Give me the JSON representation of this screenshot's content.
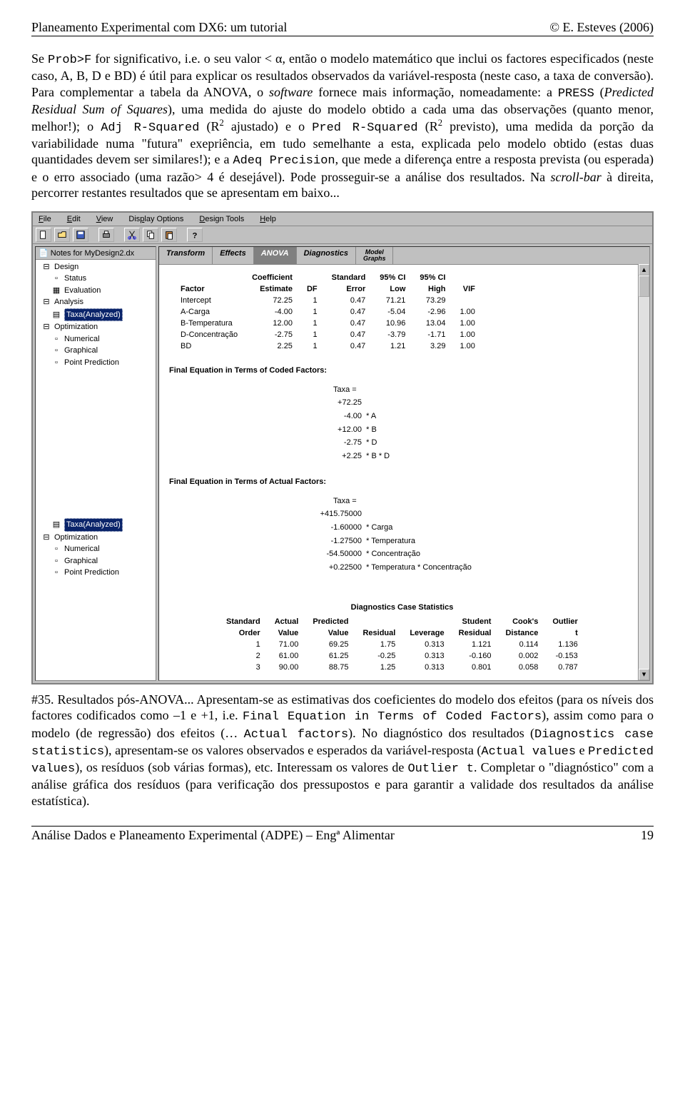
{
  "header": {
    "left": "Planeamento Experimental com DX6: um tutorial",
    "right": "© E. Esteves (2006)"
  },
  "para1": {
    "t1": "Se ",
    "t2": "Prob>F",
    "t3": " for significativo, i.e. o seu valor < α, então o modelo matemático que inclui os factores especificados (neste caso, A, B, D e BD) é útil para explicar os resultados observados da variável-resposta (neste caso, a taxa de conversão). Para complementar a tabela da ANOVA, o ",
    "t4": "software",
    "t5": " fornece mais informação, nomeadamente: a ",
    "t6": "PRESS",
    "t7": " (",
    "t8": "Predicted Residual Sum of Squares",
    "t9": "), uma medida do ajuste do modelo obtido a cada uma das observações (quanto menor, melhor!); o ",
    "t10": "Adj R-Squared",
    "t11": " (R",
    "t12": " ajustado) e o ",
    "t13": "Pred R-Squared",
    "t14": " (R",
    "t15": " previsto), uma medida da porção da variabilidade numa \"futura\" exepriência, em tudo semelhante a esta, explicada pelo modelo obtido (estas duas quantidades devem ser similares!); e a ",
    "t16": "Adeq Precision",
    "t17": ", que mede a diferença entre a resposta prevista (ou esperada) e o erro associado (uma razão> 4 é desejável). Pode prosseguir-se a análise dos resultados. Na ",
    "t18": "scroll-bar",
    "t19": " à direita, percorrer restantes resultados que se apresentam em baixo..."
  },
  "app": {
    "menu": [
      "File",
      "Edit",
      "View",
      "Display Options",
      "Design Tools",
      "Help"
    ],
    "sidebar_title": "Notes for MyDesign2.dx",
    "tree": {
      "design": "Design",
      "status": "Status",
      "evaluation": "Evaluation",
      "analysis": "Analysis",
      "taxa": "Taxa(Analyzed)",
      "optimization": "Optimization",
      "numerical": "Numerical",
      "graphical": "Graphical",
      "point": "Point Prediction"
    },
    "tabs": {
      "transform": "Transform",
      "effects": "Effects",
      "anova": "ANOVA",
      "diagnostics": "Diagnostics",
      "model_graphs_l1": "Model",
      "model_graphs_l2": "Graphs"
    },
    "coef_table": {
      "h_coef": "Coefficient",
      "h_std": "Standard",
      "h_ci1": "95% CI",
      "h_ci2": "95% CI",
      "h_factor": "Factor",
      "h_est": "Estimate",
      "h_df": "DF",
      "h_err": "Error",
      "h_low": "Low",
      "h_high": "High",
      "h_vif": "VIF",
      "rows": [
        {
          "f": "Intercept",
          "est": "72.25",
          "df": "1",
          "err": "0.47",
          "low": "71.21",
          "high": "73.29",
          "vif": ""
        },
        {
          "f": "A-Carga",
          "est": "-4.00",
          "df": "1",
          "err": "0.47",
          "low": "-5.04",
          "high": "-2.96",
          "vif": "1.00"
        },
        {
          "f": "B-Temperatura",
          "est": "12.00",
          "df": "1",
          "err": "0.47",
          "low": "10.96",
          "high": "13.04",
          "vif": "1.00"
        },
        {
          "f": "D-Concentração",
          "est": "-2.75",
          "df": "1",
          "err": "0.47",
          "low": "-3.79",
          "high": "-1.71",
          "vif": "1.00"
        },
        {
          "f": "BD",
          "est": "2.25",
          "df": "1",
          "err": "0.47",
          "low": "1.21",
          "high": "3.29",
          "vif": "1.00"
        }
      ]
    },
    "eq_coded": {
      "title": "Final Equation in Terms of Coded Factors:",
      "lhs": "Taxa  =",
      "lines": [
        {
          "v": "+72.25",
          "f": ""
        },
        {
          "v": "-4.00",
          "f": "* A"
        },
        {
          "v": "+12.00",
          "f": "* B"
        },
        {
          "v": "-2.75",
          "f": "* D"
        },
        {
          "v": "+2.25",
          "f": "* B * D"
        }
      ]
    },
    "eq_actual": {
      "title": "Final Equation in Terms of Actual Factors:",
      "lhs": "Taxa  =",
      "lines": [
        {
          "v": "+415.75000",
          "f": ""
        },
        {
          "v": "-1.60000",
          "f": "* Carga"
        },
        {
          "v": "-1.27500",
          "f": "* Temperatura"
        },
        {
          "v": "-54.50000",
          "f": "* Concentração"
        },
        {
          "v": "+0.22500",
          "f": "* Temperatura * Concentração"
        }
      ]
    },
    "diag": {
      "title": "Diagnostics Case Statistics",
      "h_std": "Standard",
      "h_act": "Actual",
      "h_pred": "Predicted",
      "h_stu": "Student",
      "h_cook": "Cook's",
      "h_out": "Outlier",
      "h_order": "Order",
      "h_val": "Value",
      "h_val2": "Value",
      "h_res": "Residual",
      "h_lev": "Leverage",
      "h_res2": "Residual",
      "h_dist": "Distance",
      "h_t": "t",
      "rows": [
        {
          "o": "1",
          "av": "71.00",
          "pv": "69.25",
          "r": "1.75",
          "l": "0.313",
          "sr": "1.121",
          "cd": "0.114",
          "t": "1.136"
        },
        {
          "o": "2",
          "av": "61.00",
          "pv": "61.25",
          "r": "-0.25",
          "l": "0.313",
          "sr": "-0.160",
          "cd": "0.002",
          "t": "-0.153"
        },
        {
          "o": "3",
          "av": "90.00",
          "pv": "88.75",
          "r": "1.25",
          "l": "0.313",
          "sr": "0.801",
          "cd": "0.058",
          "t": "0.787"
        }
      ]
    }
  },
  "para2": {
    "t1": "#35. Resultados pós-ANOVA... Apresentam-se as estimativas dos coeficientes do modelo dos efeitos (para os níveis dos factores codificados como –1 e +1, i.e. ",
    "t2": "Final Equation in Terms of Coded Factors",
    "t3": "), assim como para o modelo (de regressão) dos efeitos (… ",
    "t4": "Actual factors",
    "t5": "). No diagnóstico dos resultados (",
    "t6": "Diagnostics case statistics",
    "t7": "), apresentam-se os valores observados e esperados da variável-resposta (",
    "t8": "Actual values",
    "t9": " e ",
    "t10": "Predicted values",
    "t11": "), os resíduos (sob várias formas), etc. Interessam os valores de ",
    "t12": "Outlier t",
    "t13": ". Completar o \"diagnóstico\" com a análise gráfica dos resíduos (para verificação dos pressupostos e para garantir a validade dos resultados da análise estatística)."
  },
  "footer": {
    "left": "Análise Dados e Planeamento Experimental (ADPE) – Engª Alimentar",
    "right": "19"
  }
}
